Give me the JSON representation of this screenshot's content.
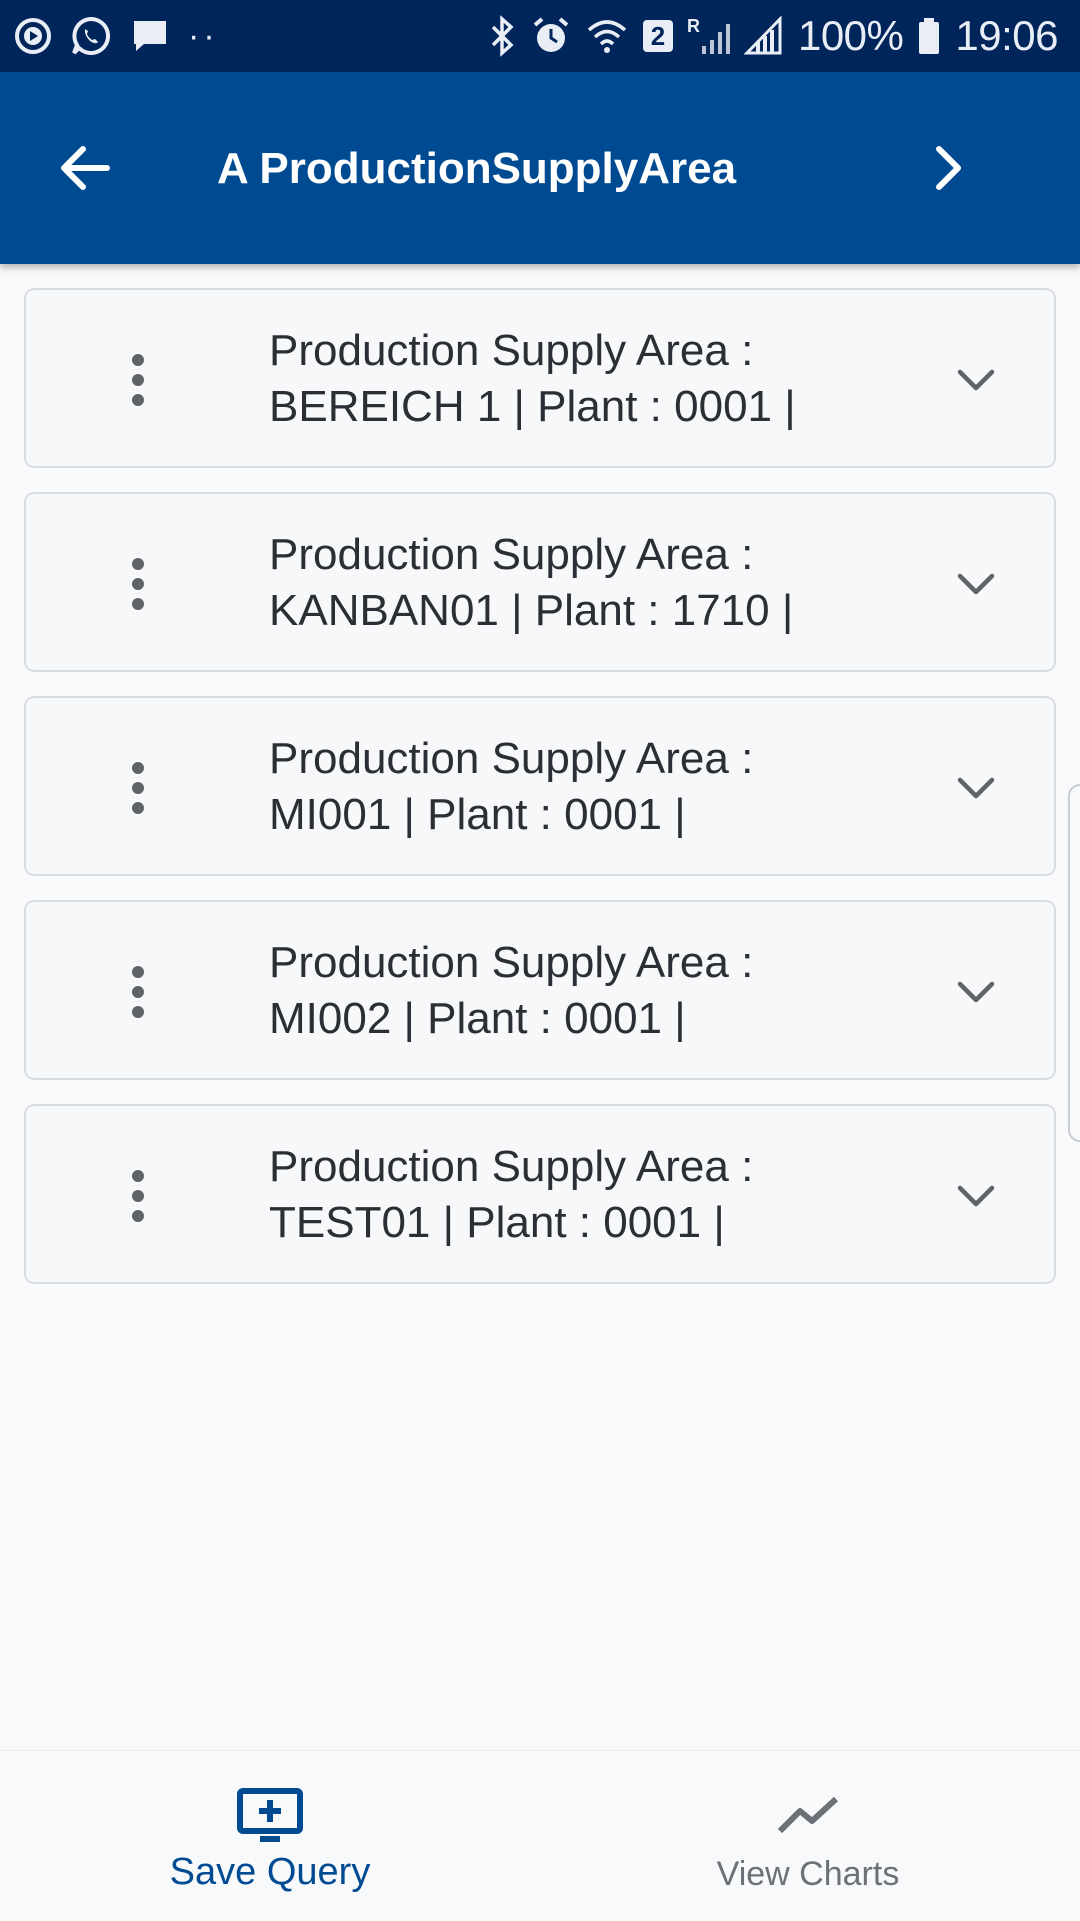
{
  "status_bar": {
    "battery": "100%",
    "time": "19:06",
    "sim_badge": "2",
    "roaming": "R"
  },
  "header": {
    "title": "A ProductionSupplyArea"
  },
  "items": [
    {
      "line1": "Production Supply Area :",
      "line2": "BEREICH 1 | Plant : 0001 |"
    },
    {
      "line1": "Production Supply Area :",
      "line2": "KANBAN01 | Plant : 1710 |"
    },
    {
      "line1": "Production Supply Area :",
      "line2": "MI001 | Plant : 0001 |"
    },
    {
      "line1": "Production Supply Area :",
      "line2": "MI002 | Plant : 0001 |"
    },
    {
      "line1": "Production Supply Area :",
      "line2": "TEST01 | Plant : 0001 |"
    }
  ],
  "bottom_nav": {
    "save_query": "Save Query",
    "view_charts": "View Charts"
  },
  "colors": {
    "status_bar": "#00255a",
    "app_bar": "#004a91",
    "accent": "#004a91",
    "inactive": "#6d7177"
  }
}
